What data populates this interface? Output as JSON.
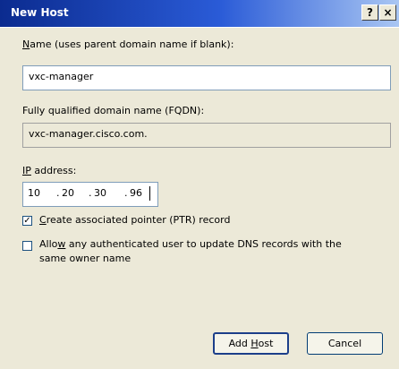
{
  "window": {
    "title": "New Host",
    "help_label": "?",
    "close_label": "×"
  },
  "name": {
    "label_mnemonic": "N",
    "label_rest": "ame (uses parent domain name if blank):",
    "value": "vxc-manager"
  },
  "fqdn": {
    "label": "Fully qualified domain name (FQDN):",
    "value": "vxc-manager.cisco.com."
  },
  "ip": {
    "label_mnemonic": "IP",
    "label_rest": " address:",
    "octets": [
      "10",
      "20",
      "30",
      "96"
    ],
    "dot": "."
  },
  "ptr": {
    "checked": true,
    "check_glyph": "✓",
    "label_mnemonic": "C",
    "label_rest": "reate associated pointer (PTR) record"
  },
  "allow_update": {
    "checked": false,
    "label_pre": "Allo",
    "label_mnemonic": "w",
    "label_rest": " any authenticated user to update DNS records with the",
    "label_line2": "same owner name"
  },
  "buttons": {
    "add_pre": "Add ",
    "add_mnemonic": "H",
    "add_rest": "ost",
    "cancel": "Cancel"
  }
}
